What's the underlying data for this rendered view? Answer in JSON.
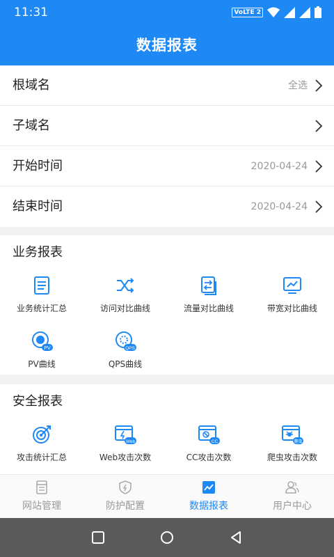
{
  "status_bar": {
    "time": "11:31",
    "volte": "VoLTE 2"
  },
  "header": {
    "title": "数据报表"
  },
  "filters": [
    {
      "label": "根域名",
      "value": "全选"
    },
    {
      "label": "子域名",
      "value": ""
    },
    {
      "label": "开始时间",
      "value": "2020-04-24"
    },
    {
      "label": "结束时间",
      "value": "2020-04-24"
    }
  ],
  "business": {
    "title": "业务报表",
    "items": [
      {
        "label": "业务统计汇总",
        "icon": "list-doc-icon"
      },
      {
        "label": "访问对比曲线",
        "icon": "shuffle-icon"
      },
      {
        "label": "流量对比曲线",
        "icon": "transfer-icon"
      },
      {
        "label": "带宽对比曲线",
        "icon": "monitor-chart-icon"
      },
      {
        "label": "PV曲线",
        "icon": "pv-clock-icon",
        "badge": "PV"
      },
      {
        "label": "QPS曲线",
        "icon": "qps-gauge-icon",
        "badge": "QPS"
      }
    ]
  },
  "security": {
    "title": "安全报表",
    "items": [
      {
        "label": "攻击统计汇总",
        "icon": "target-icon"
      },
      {
        "label": "Web攻击次数",
        "icon": "web-attack-icon",
        "badge": "Web"
      },
      {
        "label": "CC攻击次数",
        "icon": "cc-attack-icon",
        "badge": "CC"
      },
      {
        "label": "爬虫攻击次数",
        "icon": "crawler-attack-icon",
        "badge": "爬虫"
      }
    ]
  },
  "tabs": [
    {
      "label": "网站管理",
      "icon": "website-icon",
      "active": false
    },
    {
      "label": "防护配置",
      "icon": "shield-icon",
      "active": false
    },
    {
      "label": "数据报表",
      "icon": "chart-icon",
      "active": true
    },
    {
      "label": "用户中心",
      "icon": "user-icon",
      "active": false
    }
  ],
  "colors": {
    "primary": "#1e88f5",
    "inactive": "#999999"
  }
}
